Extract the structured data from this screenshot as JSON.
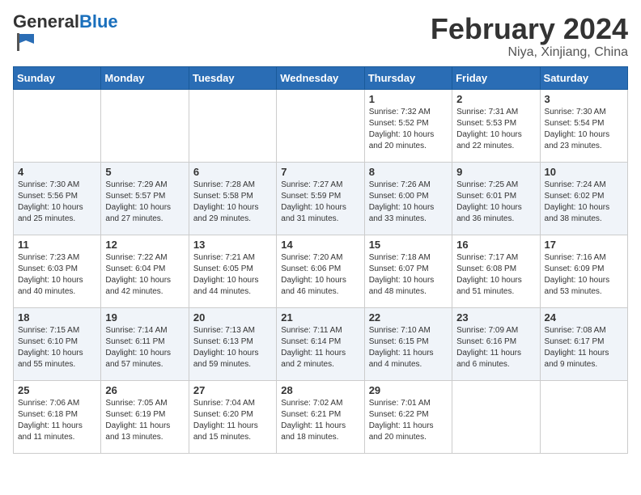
{
  "header": {
    "logo_general": "General",
    "logo_blue": "Blue",
    "title": "February 2024",
    "subtitle": "Niya, Xinjiang, China"
  },
  "weekdays": [
    "Sunday",
    "Monday",
    "Tuesday",
    "Wednesday",
    "Thursday",
    "Friday",
    "Saturday"
  ],
  "weeks": [
    [
      {
        "day": "",
        "sunrise": "",
        "sunset": "",
        "daylight": "",
        "empty": true
      },
      {
        "day": "",
        "sunrise": "",
        "sunset": "",
        "daylight": "",
        "empty": true
      },
      {
        "day": "",
        "sunrise": "",
        "sunset": "",
        "daylight": "",
        "empty": true
      },
      {
        "day": "",
        "sunrise": "",
        "sunset": "",
        "daylight": "",
        "empty": true
      },
      {
        "day": "1",
        "sunrise": "Sunrise: 7:32 AM",
        "sunset": "Sunset: 5:52 PM",
        "daylight": "Daylight: 10 hours and 20 minutes."
      },
      {
        "day": "2",
        "sunrise": "Sunrise: 7:31 AM",
        "sunset": "Sunset: 5:53 PM",
        "daylight": "Daylight: 10 hours and 22 minutes."
      },
      {
        "day": "3",
        "sunrise": "Sunrise: 7:30 AM",
        "sunset": "Sunset: 5:54 PM",
        "daylight": "Daylight: 10 hours and 23 minutes."
      }
    ],
    [
      {
        "day": "4",
        "sunrise": "Sunrise: 7:30 AM",
        "sunset": "Sunset: 5:56 PM",
        "daylight": "Daylight: 10 hours and 25 minutes."
      },
      {
        "day": "5",
        "sunrise": "Sunrise: 7:29 AM",
        "sunset": "Sunset: 5:57 PM",
        "daylight": "Daylight: 10 hours and 27 minutes."
      },
      {
        "day": "6",
        "sunrise": "Sunrise: 7:28 AM",
        "sunset": "Sunset: 5:58 PM",
        "daylight": "Daylight: 10 hours and 29 minutes."
      },
      {
        "day": "7",
        "sunrise": "Sunrise: 7:27 AM",
        "sunset": "Sunset: 5:59 PM",
        "daylight": "Daylight: 10 hours and 31 minutes."
      },
      {
        "day": "8",
        "sunrise": "Sunrise: 7:26 AM",
        "sunset": "Sunset: 6:00 PM",
        "daylight": "Daylight: 10 hours and 33 minutes."
      },
      {
        "day": "9",
        "sunrise": "Sunrise: 7:25 AM",
        "sunset": "Sunset: 6:01 PM",
        "daylight": "Daylight: 10 hours and 36 minutes."
      },
      {
        "day": "10",
        "sunrise": "Sunrise: 7:24 AM",
        "sunset": "Sunset: 6:02 PM",
        "daylight": "Daylight: 10 hours and 38 minutes."
      }
    ],
    [
      {
        "day": "11",
        "sunrise": "Sunrise: 7:23 AM",
        "sunset": "Sunset: 6:03 PM",
        "daylight": "Daylight: 10 hours and 40 minutes."
      },
      {
        "day": "12",
        "sunrise": "Sunrise: 7:22 AM",
        "sunset": "Sunset: 6:04 PM",
        "daylight": "Daylight: 10 hours and 42 minutes."
      },
      {
        "day": "13",
        "sunrise": "Sunrise: 7:21 AM",
        "sunset": "Sunset: 6:05 PM",
        "daylight": "Daylight: 10 hours and 44 minutes."
      },
      {
        "day": "14",
        "sunrise": "Sunrise: 7:20 AM",
        "sunset": "Sunset: 6:06 PM",
        "daylight": "Daylight: 10 hours and 46 minutes."
      },
      {
        "day": "15",
        "sunrise": "Sunrise: 7:18 AM",
        "sunset": "Sunset: 6:07 PM",
        "daylight": "Daylight: 10 hours and 48 minutes."
      },
      {
        "day": "16",
        "sunrise": "Sunrise: 7:17 AM",
        "sunset": "Sunset: 6:08 PM",
        "daylight": "Daylight: 10 hours and 51 minutes."
      },
      {
        "day": "17",
        "sunrise": "Sunrise: 7:16 AM",
        "sunset": "Sunset: 6:09 PM",
        "daylight": "Daylight: 10 hours and 53 minutes."
      }
    ],
    [
      {
        "day": "18",
        "sunrise": "Sunrise: 7:15 AM",
        "sunset": "Sunset: 6:10 PM",
        "daylight": "Daylight: 10 hours and 55 minutes."
      },
      {
        "day": "19",
        "sunrise": "Sunrise: 7:14 AM",
        "sunset": "Sunset: 6:11 PM",
        "daylight": "Daylight: 10 hours and 57 minutes."
      },
      {
        "day": "20",
        "sunrise": "Sunrise: 7:13 AM",
        "sunset": "Sunset: 6:13 PM",
        "daylight": "Daylight: 10 hours and 59 minutes."
      },
      {
        "day": "21",
        "sunrise": "Sunrise: 7:11 AM",
        "sunset": "Sunset: 6:14 PM",
        "daylight": "Daylight: 11 hours and 2 minutes."
      },
      {
        "day": "22",
        "sunrise": "Sunrise: 7:10 AM",
        "sunset": "Sunset: 6:15 PM",
        "daylight": "Daylight: 11 hours and 4 minutes."
      },
      {
        "day": "23",
        "sunrise": "Sunrise: 7:09 AM",
        "sunset": "Sunset: 6:16 PM",
        "daylight": "Daylight: 11 hours and 6 minutes."
      },
      {
        "day": "24",
        "sunrise": "Sunrise: 7:08 AM",
        "sunset": "Sunset: 6:17 PM",
        "daylight": "Daylight: 11 hours and 9 minutes."
      }
    ],
    [
      {
        "day": "25",
        "sunrise": "Sunrise: 7:06 AM",
        "sunset": "Sunset: 6:18 PM",
        "daylight": "Daylight: 11 hours and 11 minutes."
      },
      {
        "day": "26",
        "sunrise": "Sunrise: 7:05 AM",
        "sunset": "Sunset: 6:19 PM",
        "daylight": "Daylight: 11 hours and 13 minutes."
      },
      {
        "day": "27",
        "sunrise": "Sunrise: 7:04 AM",
        "sunset": "Sunset: 6:20 PM",
        "daylight": "Daylight: 11 hours and 15 minutes."
      },
      {
        "day": "28",
        "sunrise": "Sunrise: 7:02 AM",
        "sunset": "Sunset: 6:21 PM",
        "daylight": "Daylight: 11 hours and 18 minutes."
      },
      {
        "day": "29",
        "sunrise": "Sunrise: 7:01 AM",
        "sunset": "Sunset: 6:22 PM",
        "daylight": "Daylight: 11 hours and 20 minutes."
      },
      {
        "day": "",
        "sunrise": "",
        "sunset": "",
        "daylight": "",
        "empty": true
      },
      {
        "day": "",
        "sunrise": "",
        "sunset": "",
        "daylight": "",
        "empty": true
      }
    ]
  ]
}
